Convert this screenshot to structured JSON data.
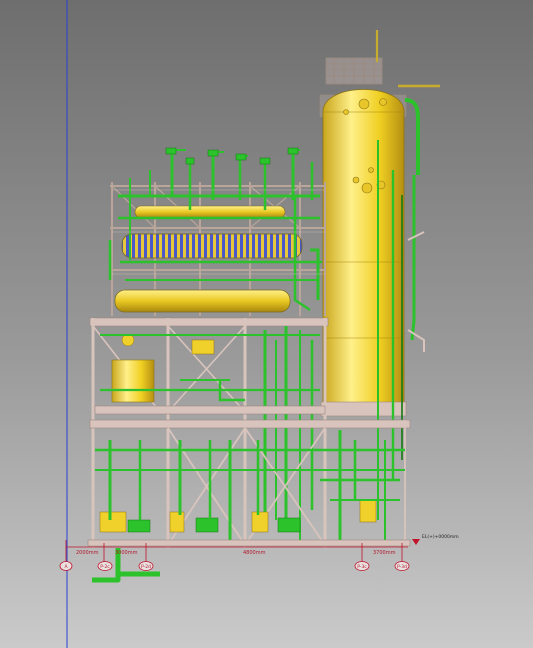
{
  "colors": {
    "background_top": "#707070",
    "background_bottom": "#c8c8c8",
    "steel": "#d8c4bc",
    "steel_dark": "#9b8780",
    "pipe": "#2bc22b",
    "pipe_dark": "#137a13",
    "vessel": "#f2d32a",
    "vessel_dark": "#b9961a",
    "dimension": "#c0132b",
    "grid_axis": "#2a3fd0"
  },
  "dimensions": {
    "dim1": "2000mm",
    "dim2": "3000mm",
    "dim3": "4800mm",
    "dim4": "3700mm"
  },
  "grid_bubbles": {
    "g1": "A",
    "g2": "P-2c",
    "g3": "P-2d",
    "g4": "P-3c",
    "g5": "P-3d"
  },
  "elevation_marker": {
    "text": "EL(+)+0000mm",
    "icon": "elevation-triangle-icon"
  }
}
